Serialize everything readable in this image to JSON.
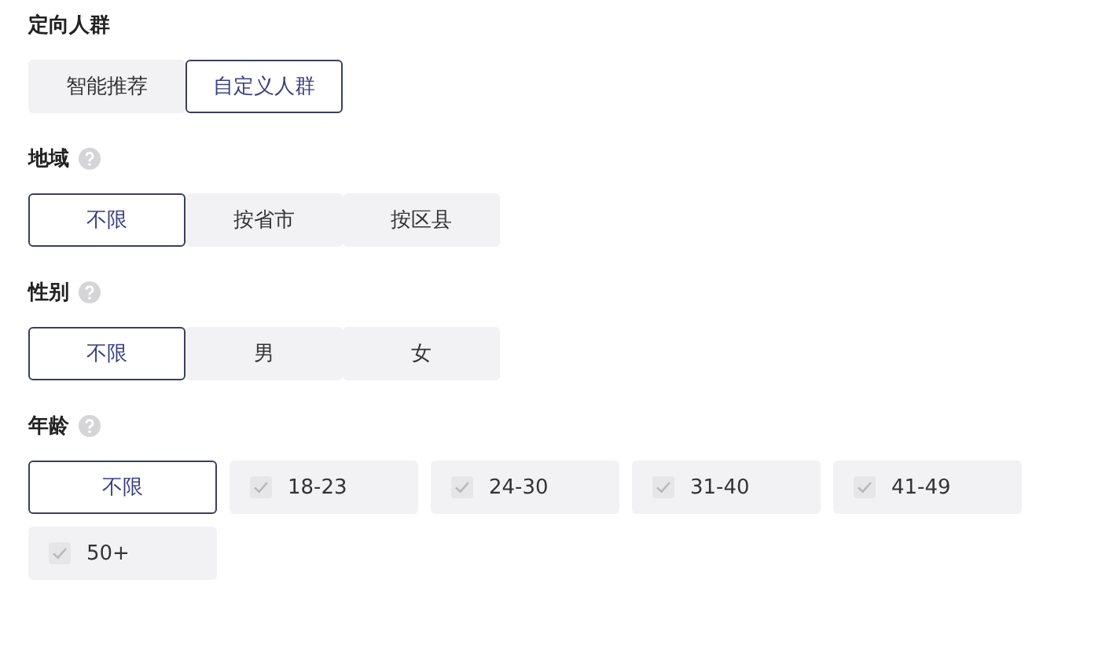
{
  "sections": [
    {
      "title": "定向人群",
      "help": false,
      "options": [
        {
          "kind": "plain",
          "label": "智能推荐",
          "selected": false
        },
        {
          "kind": "plain",
          "label": "自定义人群",
          "selected": true
        }
      ]
    },
    {
      "title": "地域",
      "help": true,
      "options": [
        {
          "kind": "plain",
          "label": "不限",
          "selected": true
        },
        {
          "kind": "plain",
          "label": "按省市",
          "selected": false
        },
        {
          "kind": "plain",
          "label": "按区县",
          "selected": false
        }
      ]
    },
    {
      "title": "性别",
      "help": true,
      "options": [
        {
          "kind": "plain",
          "label": "不限",
          "selected": true
        },
        {
          "kind": "plain",
          "label": "男",
          "selected": false
        },
        {
          "kind": "plain",
          "label": "女",
          "selected": false
        }
      ]
    },
    {
      "title": "年龄",
      "help": true,
      "options": [
        {
          "kind": "plain",
          "label": "不限",
          "selected": true
        },
        {
          "kind": "check",
          "label": "18-23",
          "checked": false
        },
        {
          "kind": "check",
          "label": "24-30",
          "checked": false
        },
        {
          "kind": "check",
          "label": "31-40",
          "checked": false
        },
        {
          "kind": "check",
          "label": "41-49",
          "checked": false
        },
        {
          "kind": "check",
          "label": "50+",
          "checked": false
        }
      ]
    }
  ]
}
